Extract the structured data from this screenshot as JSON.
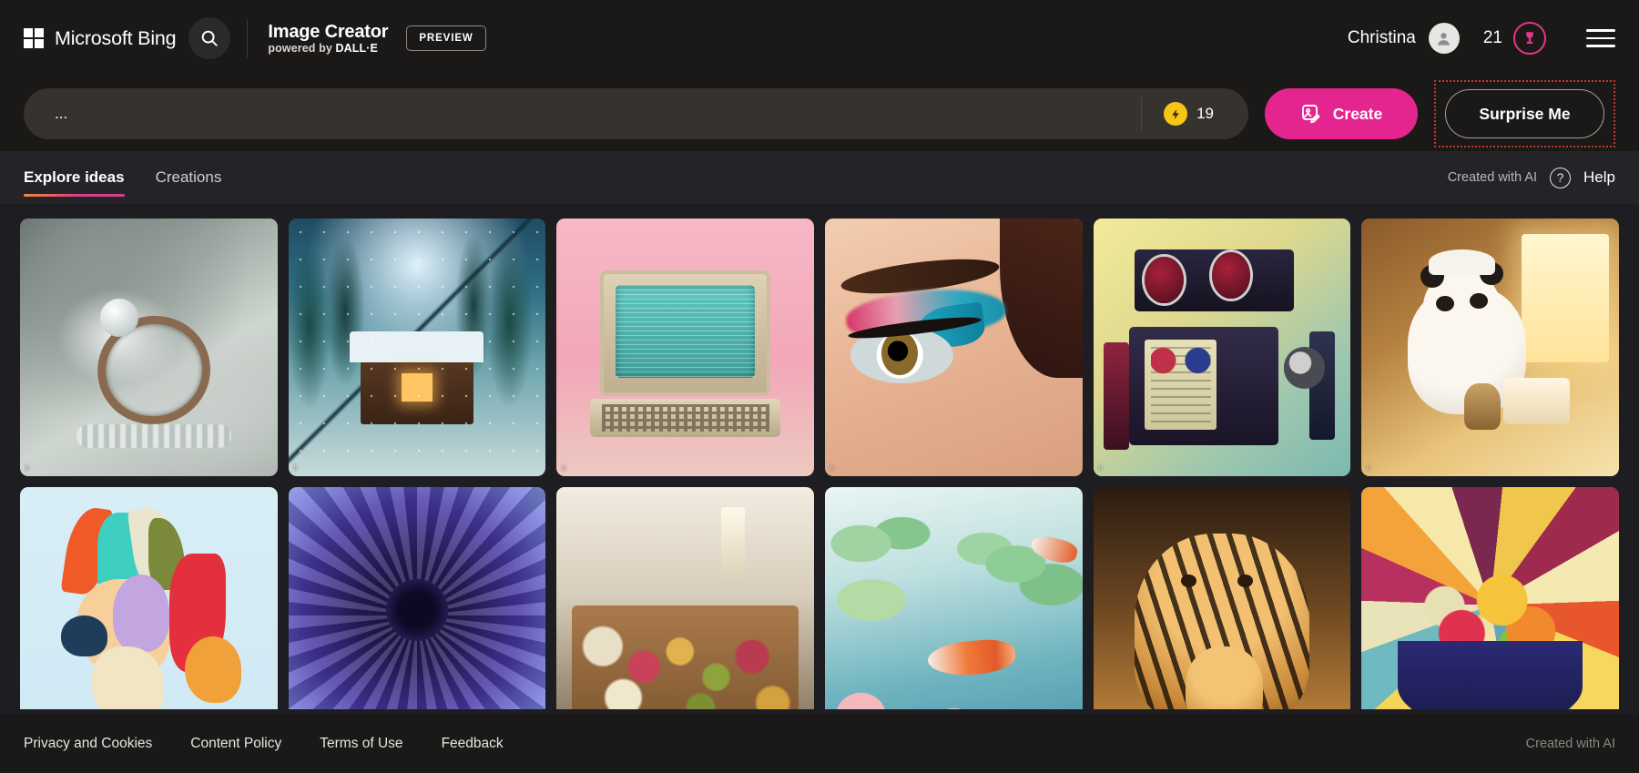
{
  "header": {
    "brand_name": "Microsoft Bing",
    "search_icon": "search-icon",
    "product_title": "Image Creator",
    "product_sub_prefix": "powered by ",
    "product_sub_dalle": "DALL·E",
    "preview_label": "PREVIEW",
    "user_name": "Christina",
    "avatar_icon": "person-icon",
    "boost_count": "21",
    "boost_icon": "boost-trophy-icon",
    "menu_icon": "hamburger-menu-icon"
  },
  "prompt": {
    "value": "...",
    "placeholder": "...",
    "boost_coin_icon": "lightning-coin-icon",
    "boost_credits": "19",
    "create_label": "Create",
    "create_icon": "image-pencil-icon",
    "create_color": "#e5258f",
    "surprise_label": "Surprise Me",
    "highlight_color": "#c0392b"
  },
  "tabs": {
    "items": [
      {
        "label": "Explore ideas",
        "active": true
      },
      {
        "label": "Creations",
        "active": false
      }
    ],
    "underline_gradient": [
      "#f0893a",
      "#e0398d"
    ],
    "created_with_ai": "Created with AI",
    "help_icon": "question-circle-icon",
    "help_label": "Help"
  },
  "gallery": {
    "watermark": "b",
    "items": [
      {
        "name": "pearl-ring-on-silk",
        "art": "art-ring"
      },
      {
        "name": "snowy-winter-cabin",
        "art": "art-cabin"
      },
      {
        "name": "retro-vintage-computer",
        "art": "art-computer"
      },
      {
        "name": "colorful-eye-makeup",
        "art": "art-eye"
      },
      {
        "name": "retro-boombox-robot",
        "art": "art-robot"
      },
      {
        "name": "panda-chef-baking-cake",
        "art": "art-panda"
      },
      {
        "name": "paper-craft-fox",
        "art": "art-fox"
      },
      {
        "name": "purple-dahlia-flower",
        "art": "art-dahlia"
      },
      {
        "name": "charcuterie-board",
        "art": "art-charcuterie"
      },
      {
        "name": "koi-pond-watercolor",
        "art": "art-koi"
      },
      {
        "name": "tiger-and-cub",
        "art": "art-tiger"
      },
      {
        "name": "geometric-fruit-bowl",
        "art": "art-fruit"
      }
    ]
  },
  "footer": {
    "links": [
      "Privacy and Cookies",
      "Content Policy",
      "Terms of Use",
      "Feedback"
    ],
    "created_with_ai": "Created with AI"
  }
}
